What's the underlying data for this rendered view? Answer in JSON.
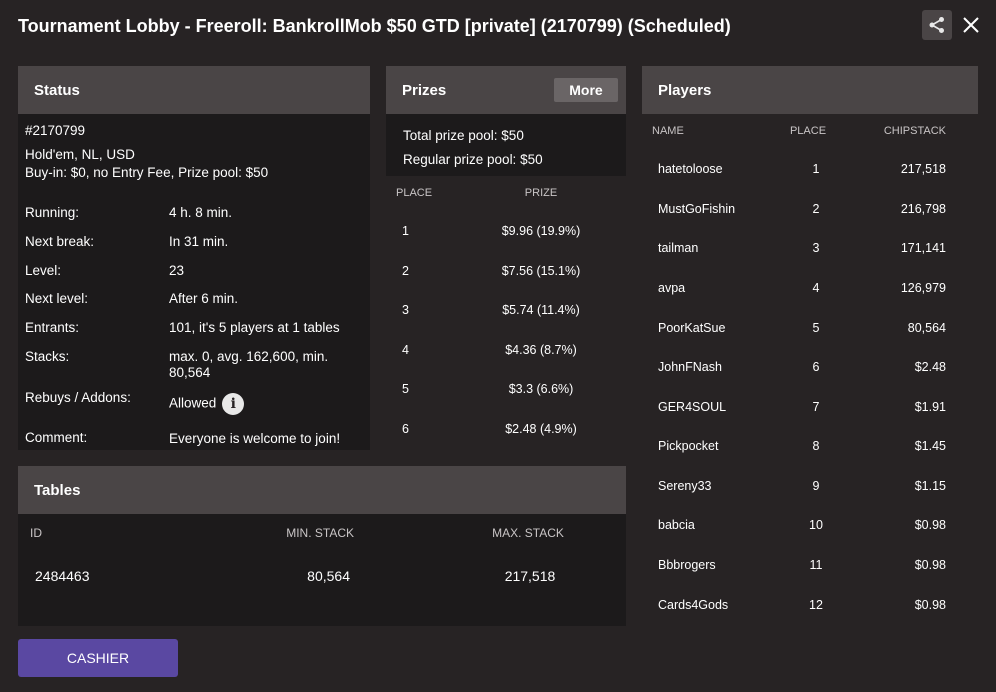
{
  "window": {
    "title": "Tournament Lobby - Freeroll: BankrollMob $50 GTD [private] (2170799) (Scheduled)"
  },
  "status": {
    "header": "Status",
    "id": "#2170799",
    "game": "Hold'em, NL, USD",
    "buyin": "Buy-in: $0, no Entry Fee, Prize pool: $50",
    "rows": [
      {
        "label": "Running:",
        "value": "4 h. 8 min."
      },
      {
        "label": "Next break:",
        "value": "In 31 min."
      },
      {
        "label": "Level:",
        "value": "23"
      },
      {
        "label": "Next level:",
        "value": "After 6 min."
      },
      {
        "label": "Entrants:",
        "value": "101, it's 5 players at 1 tables"
      },
      {
        "label": "Stacks:",
        "value": "max. 0, avg. 162,600, min. 80,564"
      },
      {
        "label": "Rebuys / Addons:",
        "value": "Allowed"
      },
      {
        "label": "Comment:",
        "value": "Everyone is welcome to join! You will find the password"
      }
    ]
  },
  "prizes": {
    "header": "Prizes",
    "more_label": "More",
    "total": "Total prize pool: $50",
    "regular": "Regular prize pool: $50",
    "col_place": "PLACE",
    "col_prize": "PRIZE",
    "rows": [
      {
        "place": "1",
        "prize": "$9.96 (19.9%)"
      },
      {
        "place": "2",
        "prize": "$7.56 (15.1%)"
      },
      {
        "place": "3",
        "prize": "$5.74 (11.4%)"
      },
      {
        "place": "4",
        "prize": "$4.36 (8.7%)"
      },
      {
        "place": "5",
        "prize": "$3.3 (6.6%)"
      },
      {
        "place": "6",
        "prize": "$2.48 (4.9%)"
      }
    ]
  },
  "players": {
    "header": "Players",
    "col_name": "NAME",
    "col_place": "PLACE",
    "col_chips": "CHIPSTACK",
    "rows": [
      {
        "name": "hatetoloose",
        "place": "1",
        "chips": "217,518"
      },
      {
        "name": "MustGoFishin",
        "place": "2",
        "chips": "216,798"
      },
      {
        "name": "tailman",
        "place": "3",
        "chips": "171,141"
      },
      {
        "name": "avpa",
        "place": "4",
        "chips": "126,979"
      },
      {
        "name": "PoorKatSue",
        "place": "5",
        "chips": "80,564"
      },
      {
        "name": "JohnFNash",
        "place": "6",
        "chips": "$2.48"
      },
      {
        "name": "GER4SOUL",
        "place": "7",
        "chips": "$1.91"
      },
      {
        "name": "Pickpocket",
        "place": "8",
        "chips": "$1.45"
      },
      {
        "name": "Sereny33",
        "place": "9",
        "chips": "$1.15"
      },
      {
        "name": "babcia",
        "place": "10",
        "chips": "$0.98"
      },
      {
        "name": "Bbbrogers",
        "place": "11",
        "chips": "$0.98"
      },
      {
        "name": "Cards4Gods",
        "place": "12",
        "chips": "$0.98"
      }
    ]
  },
  "tables": {
    "header": "Tables",
    "col_id": "ID",
    "col_min": "MIN. STACK",
    "col_max": "MAX. STACK",
    "rows": [
      {
        "id": "2484463",
        "min": "80,564",
        "max": "217,518"
      }
    ]
  },
  "cashier_label": "CASHIER"
}
